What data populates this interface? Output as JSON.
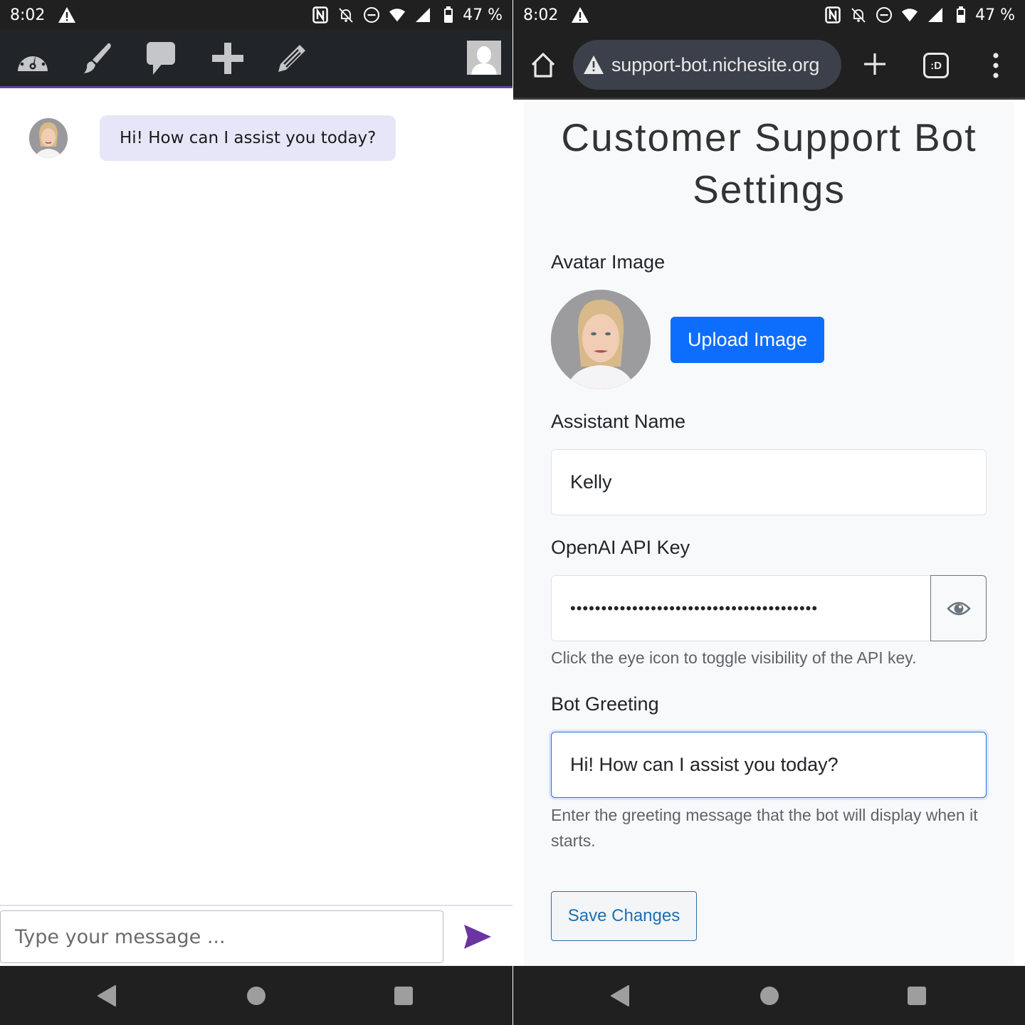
{
  "status_bar": {
    "time": "8:02",
    "battery": "47 %",
    "icons": [
      "warning-icon",
      "nfc-icon",
      "bell-off-icon",
      "do-not-disturb-icon",
      "wifi-icon",
      "signal-icon",
      "battery-icon"
    ]
  },
  "chat_app": {
    "toolbar": {
      "icons": [
        "dashboard-icon",
        "brush-icon",
        "comment-icon",
        "plus-icon",
        "pencil-icon"
      ],
      "user_icon": "user-avatar-icon"
    },
    "messages": [
      {
        "sender": "bot",
        "text": "Hi! How can I assist you today?"
      }
    ],
    "input": {
      "placeholder": "Type your message ...",
      "value": ""
    },
    "send_icon": "send-icon"
  },
  "browser": {
    "url": "support-bot.nichesite.org",
    "tab_switcher_label": ":D",
    "icons": [
      "home-icon",
      "warning-icon",
      "new-tab-icon",
      "tab-switcher-icon",
      "more-vert-icon"
    ]
  },
  "settings": {
    "title": "Customer Support Bot Settings",
    "avatar_label": "Avatar Image",
    "upload_button": "Upload Image",
    "assistant_name_label": "Assistant Name",
    "assistant_name_value": "Kelly",
    "api_key_label": "OpenAI API Key",
    "api_key_value": "••••••••••••••••••••••••••••••••••••••••",
    "api_key_help": "Click the eye icon to toggle visibility of the API key.",
    "greeting_label": "Bot Greeting",
    "greeting_value": "Hi! How can I assist you today?",
    "greeting_help": "Enter the greeting message that the bot will display when it starts.",
    "save_button": "Save Changes"
  },
  "colors": {
    "accent_purple": "#6c3fa0",
    "primary_blue": "#0d6efd",
    "bubble_bg": "#e6e6f8",
    "page_bg": "#f8f9fa"
  },
  "nav_bar": {
    "buttons": [
      "back-icon",
      "home-circle-icon",
      "recents-icon"
    ]
  }
}
